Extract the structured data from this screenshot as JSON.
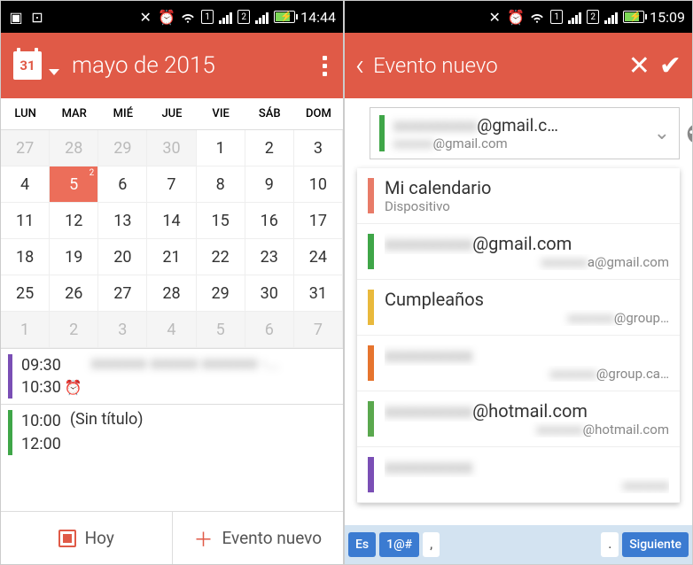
{
  "colors": {
    "accent": "#e05a47",
    "stripe_green": "#3fa648",
    "stripe_salmon": "#e87b68",
    "stripe_yellow": "#e9b93c",
    "stripe_orange": "#e6742e",
    "stripe_green2": "#5aa84e",
    "stripe_purple": "#7a4fb5",
    "stripe_blue": "#3b7bd1"
  },
  "left": {
    "status_time": "14:44",
    "appbar_title": "mayo de 2015",
    "calendar_icon_day": "31",
    "dow": [
      "LUN",
      "MAR",
      "MIÉ",
      "JUE",
      "VIE",
      "SÁB",
      "DOM"
    ],
    "weeks": [
      [
        {
          "n": "27",
          "dim": true
        },
        {
          "n": "28",
          "dim": true
        },
        {
          "n": "29",
          "dim": true
        },
        {
          "n": "30",
          "dim": true
        },
        {
          "n": "1"
        },
        {
          "n": "2"
        },
        {
          "n": "3"
        }
      ],
      [
        {
          "n": "4"
        },
        {
          "n": "5",
          "selected": true,
          "badge": "2"
        },
        {
          "n": "6"
        },
        {
          "n": "7"
        },
        {
          "n": "8"
        },
        {
          "n": "9"
        },
        {
          "n": "10"
        }
      ],
      [
        {
          "n": "11"
        },
        {
          "n": "12"
        },
        {
          "n": "13"
        },
        {
          "n": "14"
        },
        {
          "n": "15"
        },
        {
          "n": "16"
        },
        {
          "n": "17"
        }
      ],
      [
        {
          "n": "18"
        },
        {
          "n": "19"
        },
        {
          "n": "20"
        },
        {
          "n": "21"
        },
        {
          "n": "22"
        },
        {
          "n": "23"
        },
        {
          "n": "24"
        }
      ],
      [
        {
          "n": "25"
        },
        {
          "n": "26"
        },
        {
          "n": "27"
        },
        {
          "n": "28"
        },
        {
          "n": "29"
        },
        {
          "n": "30"
        },
        {
          "n": "31"
        }
      ],
      [
        {
          "n": "1",
          "dim": true
        },
        {
          "n": "2",
          "dim": true
        },
        {
          "n": "3",
          "dim": true
        },
        {
          "n": "4",
          "dim": true
        },
        {
          "n": "5",
          "dim": true
        },
        {
          "n": "6",
          "dim": true
        },
        {
          "n": "7",
          "dim": true
        }
      ]
    ],
    "events": [
      {
        "start": "09:30",
        "end": "10:30",
        "title": "",
        "alarm": true,
        "color": "#7a4fb5",
        "blurred": true
      },
      {
        "start": "10:00",
        "end": "12:00",
        "title": "(Sin título)",
        "alarm": false,
        "color": "#3fa648"
      }
    ],
    "bottom": {
      "today": "Hoy",
      "new_event": "Evento nuevo"
    }
  },
  "right": {
    "status_time": "15:09",
    "appbar_title": "Evento nuevo",
    "selector": {
      "primary_suffix": "@gmail.c…",
      "secondary_suffix": "@gmail.com",
      "stripe": "#3fa648"
    },
    "dropdown": [
      {
        "stripe": "#e87b68",
        "primary": "Mi calendario",
        "secondary": "Dispositivo",
        "secondary_align": "left"
      },
      {
        "stripe": "#3fa648",
        "primary_blur": true,
        "primary_suffix": "@gmail.com",
        "secondary_blur": true,
        "secondary_suffix": "a@gmail.com"
      },
      {
        "stripe": "#e9b93c",
        "primary": "Cumpleaños",
        "secondary_blur": true,
        "secondary_suffix": "@group…"
      },
      {
        "stripe": "#e6742e",
        "primary_blur": true,
        "primary_suffix": "",
        "secondary_blur": true,
        "secondary_suffix": "@group.ca…"
      },
      {
        "stripe": "#5aa84e",
        "primary_blur": true,
        "primary_suffix": "@hotmail.com",
        "secondary_blur": true,
        "secondary_suffix": "@hotmail.com"
      },
      {
        "stripe": "#7a4fb5",
        "primary_blur": true,
        "primary_suffix": "",
        "secondary_blur": true,
        "secondary_suffix": ""
      }
    ],
    "keyboard": {
      "lang": "Es",
      "sym": "1@#",
      "comma": ",",
      "dot": ".",
      "next": "Siguiente"
    }
  }
}
